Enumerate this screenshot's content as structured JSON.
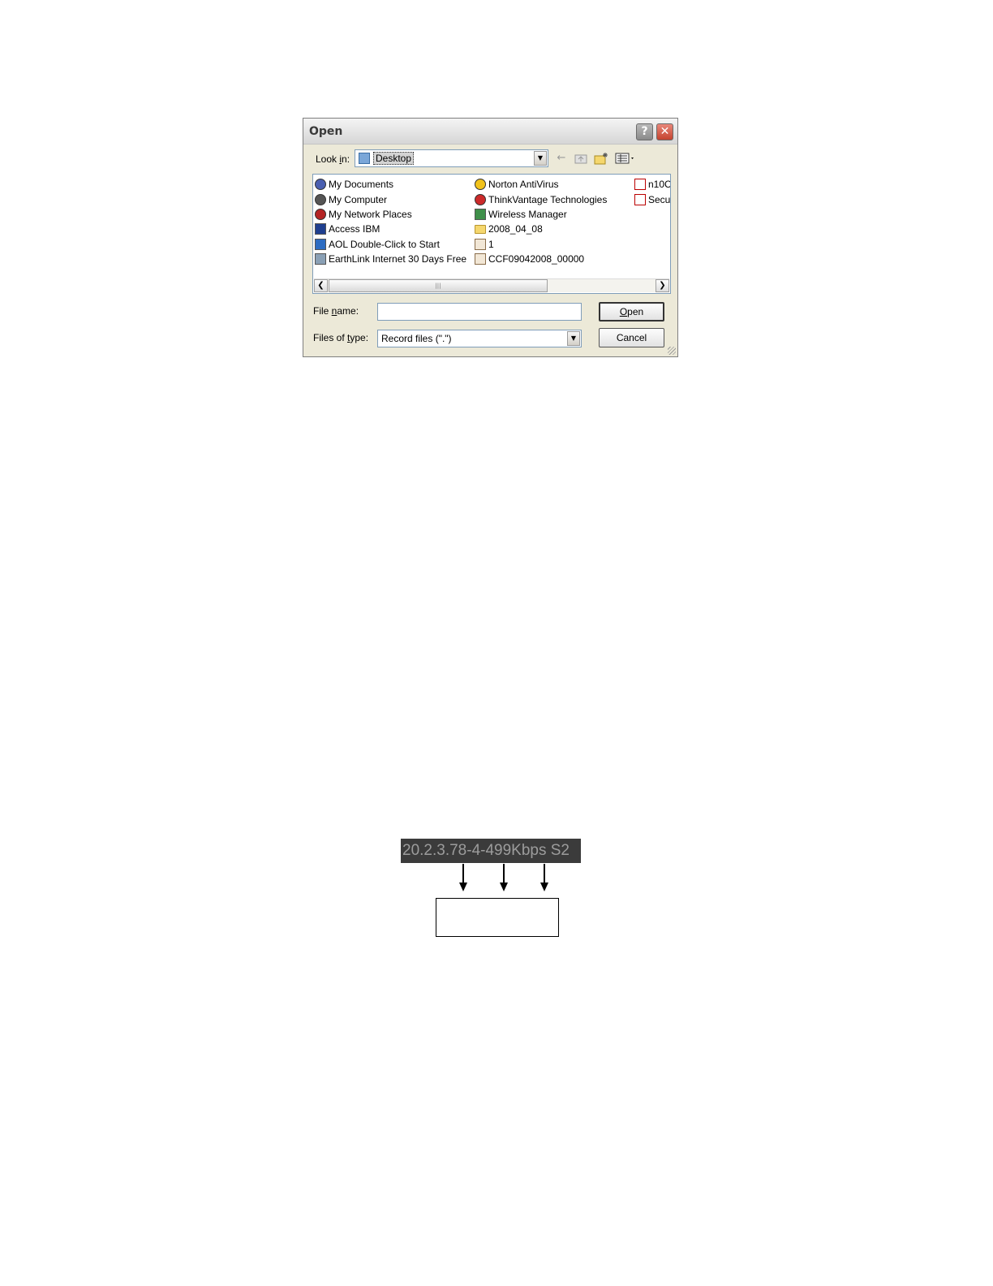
{
  "dialog": {
    "title": "Open",
    "help_glyph": "?",
    "close_glyph": "✕",
    "look_in_label_pre": "Look ",
    "look_in_label_ul": "i",
    "look_in_label_post": "n:",
    "look_in_value": "Desktop",
    "toolbar_icons": [
      "back-icon",
      "up-folder-icon",
      "new-folder-icon",
      "views-menu-icon"
    ],
    "files": {
      "col1": [
        {
          "label": "My Documents",
          "icon": "my-documents-icon"
        },
        {
          "label": "My Computer",
          "icon": "my-computer-icon"
        },
        {
          "label": "My Network Places",
          "icon": "network-places-icon"
        },
        {
          "label": "Access IBM",
          "icon": "access-ibm-icon"
        },
        {
          "label": "AOL Double-Click to Start",
          "icon": "aol-icon"
        },
        {
          "label": "EarthLink Internet 30 Days Free",
          "icon": "earthlink-icon"
        }
      ],
      "col2": [
        {
          "label": "Norton AntiVirus",
          "icon": "norton-icon"
        },
        {
          "label": "ThinkVantage Technologies",
          "icon": "thinkvantage-icon"
        },
        {
          "label": "Wireless Manager",
          "icon": "wireless-manager-icon"
        },
        {
          "label": "2008_04_08",
          "icon": "folder-icon"
        },
        {
          "label": "1",
          "icon": "record-file-icon"
        },
        {
          "label": "CCF09042008_00000",
          "icon": "record-file-icon"
        }
      ],
      "col3": [
        {
          "label": "n10C",
          "icon": "pdf-icon"
        },
        {
          "label": "Secu",
          "icon": "pdf-icon"
        }
      ]
    },
    "file_name_label_pre": "File ",
    "file_name_label_ul": "n",
    "file_name_label_post": "ame:",
    "file_name_value": "",
    "files_of_type_label_pre": "Files of ",
    "files_of_type_label_ul": "t",
    "files_of_type_label_post": "ype:",
    "files_of_type_value": "Record files (\".\")",
    "open_button_ul": "O",
    "open_button_rest": "pen",
    "cancel_button": "Cancel"
  },
  "osd": {
    "text": "20.2.3.78-4-499Kbps S2"
  }
}
